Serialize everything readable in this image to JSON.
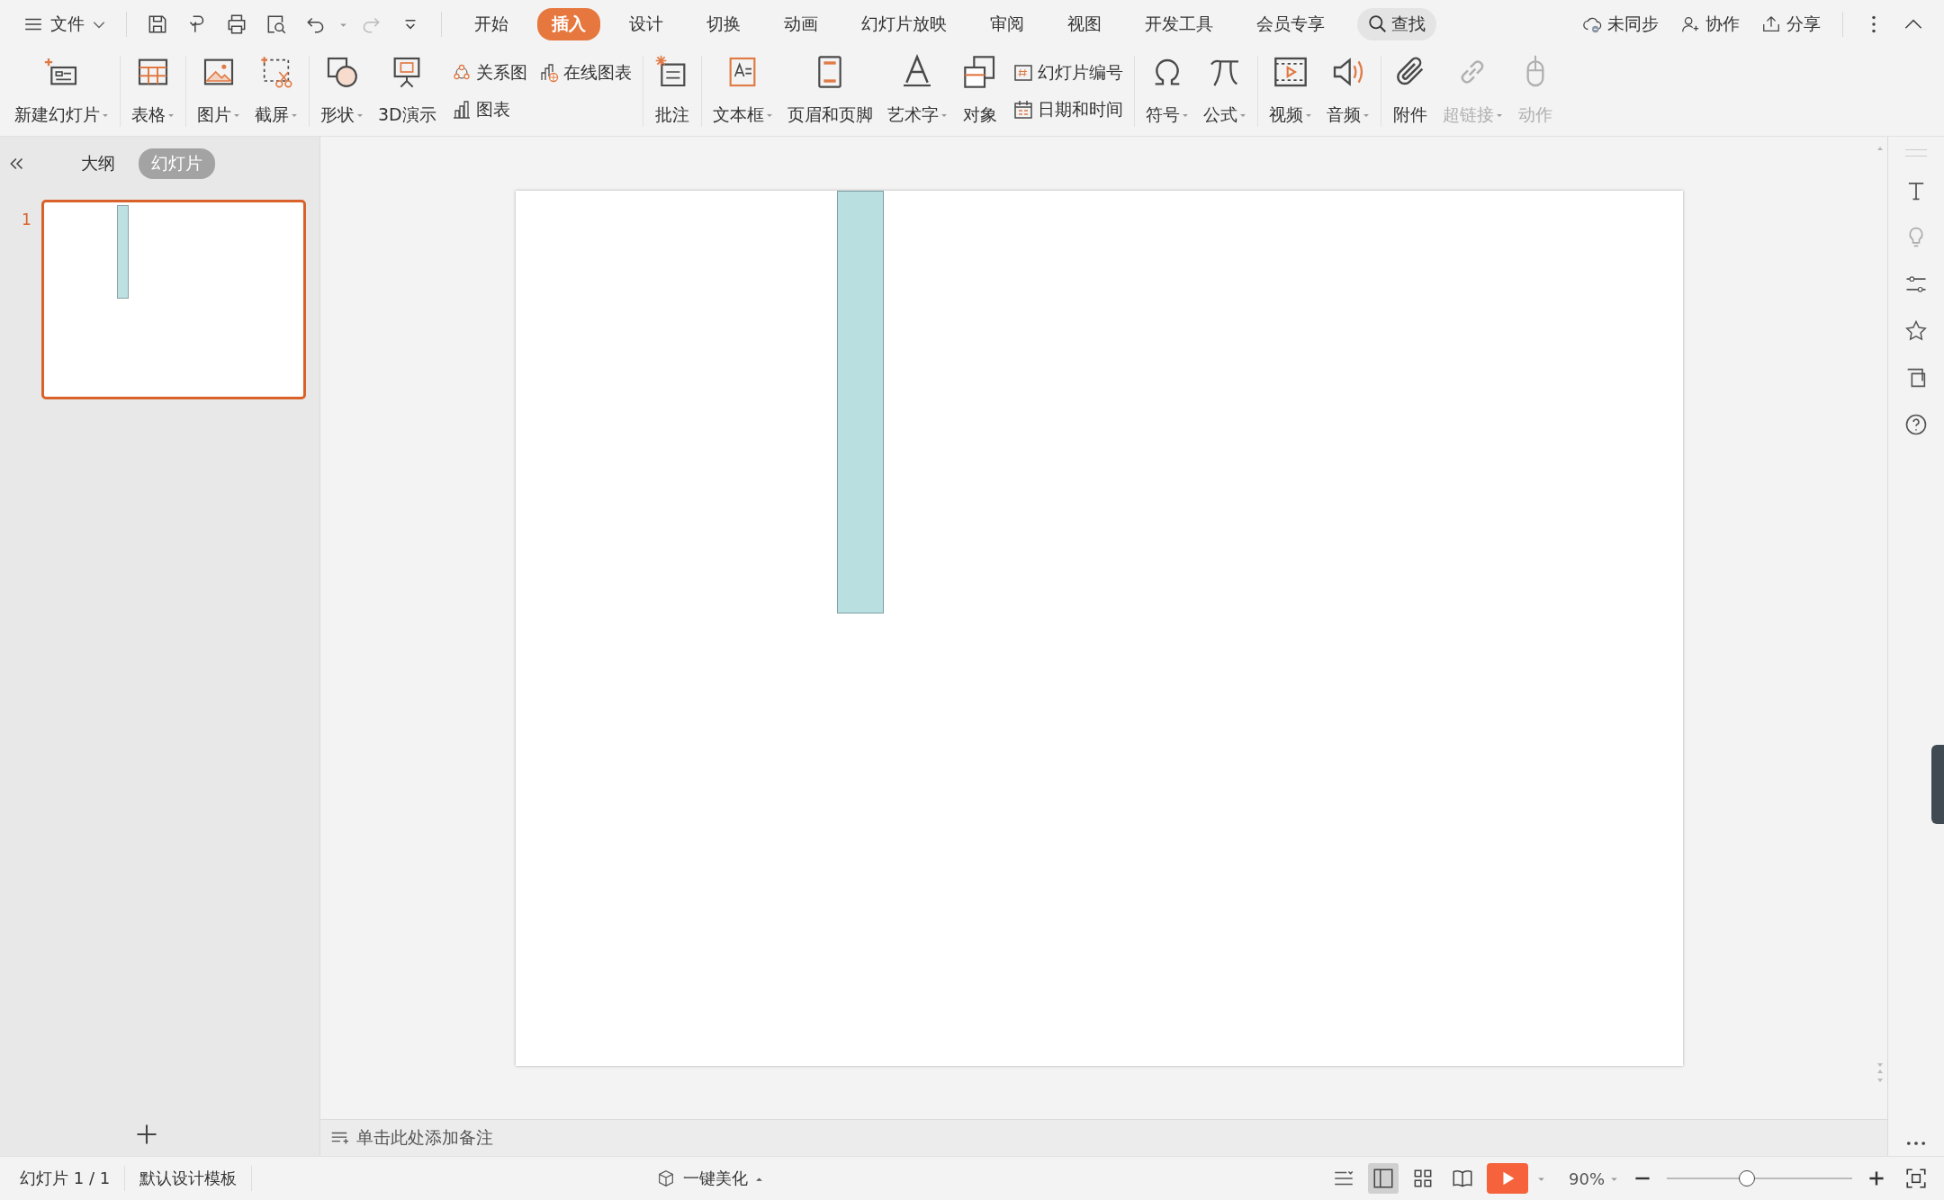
{
  "menu": {
    "file": "文件",
    "tabs": [
      {
        "label": "开始",
        "selected": false
      },
      {
        "label": "插入",
        "selected": true
      },
      {
        "label": "设计",
        "selected": false
      },
      {
        "label": "切换",
        "selected": false
      },
      {
        "label": "动画",
        "selected": false
      },
      {
        "label": "幻灯片放映",
        "selected": false
      },
      {
        "label": "审阅",
        "selected": false
      },
      {
        "label": "视图",
        "selected": false
      },
      {
        "label": "开发工具",
        "selected": false
      },
      {
        "label": "会员专享",
        "selected": false
      }
    ],
    "search": "查找",
    "actions": [
      "未同步",
      "协作",
      "分享"
    ]
  },
  "ribbon": {
    "groups": [
      {
        "items": [
          {
            "kind": "big",
            "label": "新建幻灯片",
            "dropdown": true,
            "disabled": false
          }
        ]
      },
      {
        "items": [
          {
            "kind": "big",
            "label": "表格",
            "dropdown": true,
            "disabled": false
          }
        ]
      },
      {
        "items": [
          {
            "kind": "big",
            "label": "图片",
            "dropdown": true,
            "disabled": false
          },
          {
            "kind": "big",
            "label": "截屏",
            "dropdown": true,
            "disabled": false
          }
        ]
      },
      {
        "items": [
          {
            "kind": "big",
            "label": "形状",
            "dropdown": true,
            "disabled": false
          },
          {
            "kind": "big",
            "label": "3D演示",
            "dropdown": false,
            "disabled": false
          },
          {
            "kind": "stack",
            "rows": [
              [
                {
                  "label": "关系图"
                },
                {
                  "label": "在线图表"
                }
              ],
              [
                {
                  "label": "图表"
                }
              ]
            ]
          }
        ]
      },
      {
        "items": [
          {
            "kind": "big",
            "label": "批注",
            "dropdown": false,
            "disabled": false
          }
        ]
      },
      {
        "items": [
          {
            "kind": "big",
            "label": "文本框",
            "dropdown": true,
            "disabled": false
          },
          {
            "kind": "big",
            "label": "页眉和页脚",
            "dropdown": false,
            "disabled": false
          },
          {
            "kind": "big",
            "label": "艺术字",
            "dropdown": true,
            "disabled": false
          },
          {
            "kind": "big",
            "label": "对象",
            "dropdown": false,
            "disabled": false
          },
          {
            "kind": "stack",
            "rows": [
              [
                {
                  "label": "幻灯片编号"
                }
              ],
              [
                {
                  "label": "日期和时间"
                }
              ]
            ]
          }
        ]
      },
      {
        "items": [
          {
            "kind": "big",
            "label": "符号",
            "dropdown": true,
            "disabled": false
          },
          {
            "kind": "big",
            "label": "公式",
            "dropdown": true,
            "disabled": false
          }
        ]
      },
      {
        "items": [
          {
            "kind": "big",
            "label": "视频",
            "dropdown": true,
            "disabled": false
          },
          {
            "kind": "big",
            "label": "音频",
            "dropdown": true,
            "disabled": false
          }
        ]
      },
      {
        "items": [
          {
            "kind": "big",
            "label": "附件",
            "dropdown": false,
            "disabled": false
          },
          {
            "kind": "big",
            "label": "超链接",
            "dropdown": true,
            "disabled": true
          },
          {
            "kind": "big",
            "label": "动作",
            "dropdown": false,
            "disabled": true
          }
        ]
      }
    ]
  },
  "panel": {
    "tabs": [
      {
        "label": "大纲",
        "selected": false
      },
      {
        "label": "幻灯片",
        "selected": true
      }
    ],
    "slides": [
      {
        "number": "1",
        "selected": true
      }
    ]
  },
  "notes": {
    "placeholder": "单击此处添加备注"
  },
  "status": {
    "slide": "幻灯片 1 / 1",
    "template": "默认设计模板",
    "beautify": "一键美化",
    "zoom": "90%",
    "level": 0.43
  }
}
